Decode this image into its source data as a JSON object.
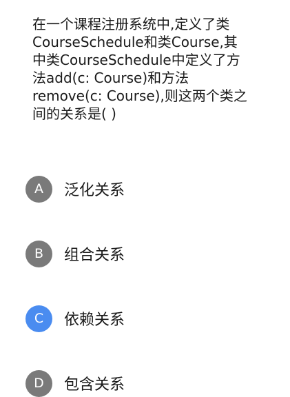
{
  "question": {
    "text": "在一个课程注册系统中,定义了类\nCourseSchedule和类Course,其\n中类CourseSchedule中定义了方\n法add(c: Course)和方法\nremove(c: Course),则这两个类之\n间的关系是(    )"
  },
  "options": [
    {
      "letter": "A",
      "text": "泛化关系",
      "selected": false
    },
    {
      "letter": "B",
      "text": "组合关系",
      "selected": false
    },
    {
      "letter": "C",
      "text": "依赖关系",
      "selected": true
    },
    {
      "letter": "D",
      "text": "包含关系",
      "selected": false
    }
  ],
  "colors": {
    "badge_default": "#7a7a7a",
    "badge_selected": "#4a8cf0",
    "text": "#1a1a1a"
  }
}
